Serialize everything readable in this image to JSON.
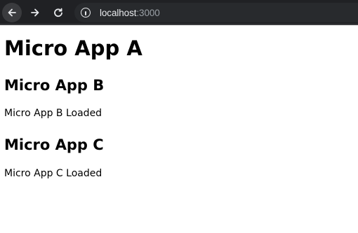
{
  "browser": {
    "url_host": "localhost",
    "url_port": ":3000",
    "icons": [
      "back-arrow-icon",
      "forward-arrow-icon",
      "reload-icon",
      "info-icon"
    ]
  },
  "page": {
    "app_a_title": "Micro App A",
    "app_b_title": "Micro App B",
    "app_b_status": "Micro App B Loaded",
    "app_c_title": "Micro App C",
    "app_c_status": "Micro App C Loaded"
  }
}
